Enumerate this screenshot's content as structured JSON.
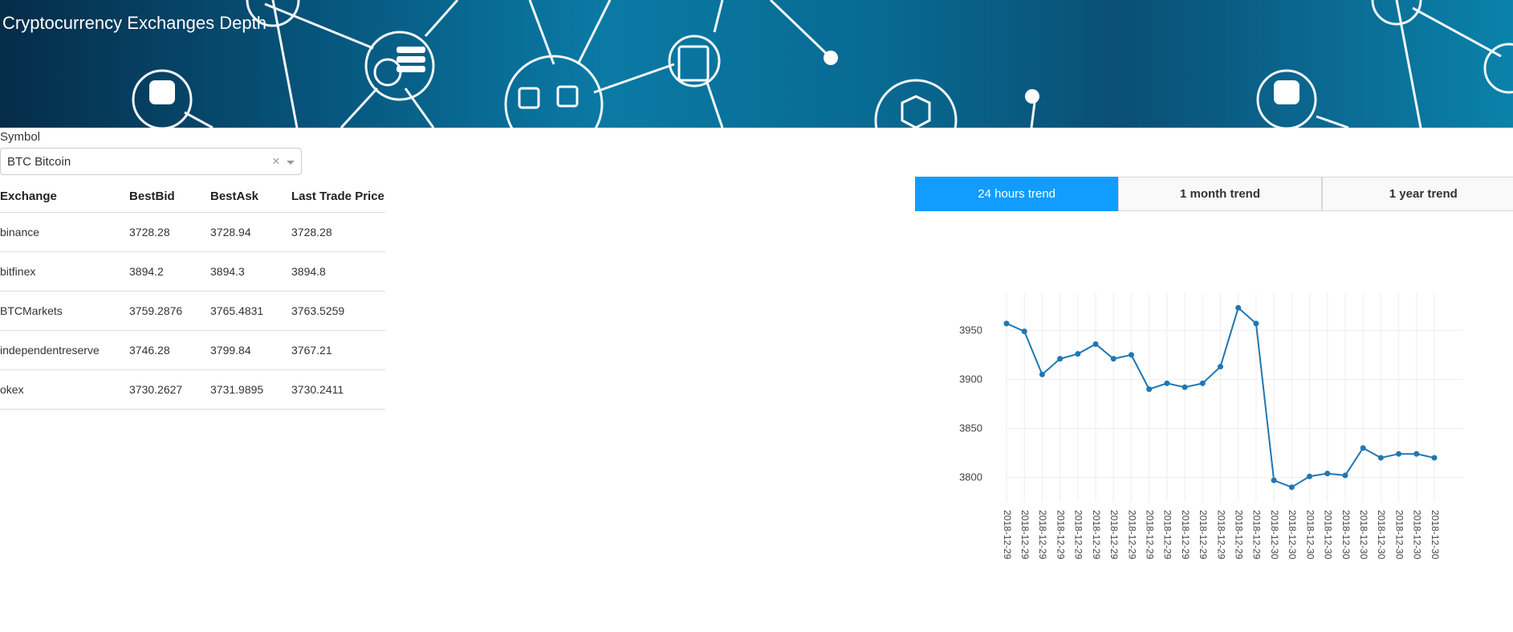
{
  "banner": {
    "title": "Cryptocurrency Exchanges Depth"
  },
  "symbol": {
    "label": "Symbol",
    "value": "BTC Bitcoin",
    "clear": "×"
  },
  "table": {
    "headers": [
      "Exchange",
      "BestBid",
      "BestAsk",
      "Last Trade Price"
    ],
    "rows": [
      [
        "binance",
        "3728.28",
        "3728.94",
        "3728.28"
      ],
      [
        "bitfinex",
        "3894.2",
        "3894.3",
        "3894.8"
      ],
      [
        "BTCMarkets",
        "3759.2876",
        "3765.4831",
        "3763.5259"
      ],
      [
        "independentreserve",
        "3746.28",
        "3799.84",
        "3767.21"
      ],
      [
        "okex",
        "3730.2627",
        "3731.9895",
        "3730.2411"
      ]
    ]
  },
  "tabs": [
    {
      "label": "24 hours trend",
      "active": true
    },
    {
      "label": "1 month trend",
      "active": false
    },
    {
      "label": "1 year trend",
      "active": false
    }
  ],
  "colors": {
    "accent": "#119dff",
    "line": "#1f77b4",
    "banner": "#07577e"
  },
  "chart_data": {
    "type": "line",
    "x": [
      "2018-12-29",
      "2018-12-29",
      "2018-12-29",
      "2018-12-29",
      "2018-12-29",
      "2018-12-29",
      "2018-12-29",
      "2018-12-29",
      "2018-12-29",
      "2018-12-29",
      "2018-12-29",
      "2018-12-29",
      "2018-12-29",
      "2018-12-29",
      "2018-12-29",
      "2018-12-30",
      "2018-12-30",
      "2018-12-30",
      "2018-12-30",
      "2018-12-30",
      "2018-12-30",
      "2018-12-30",
      "2018-12-30",
      "2018-12-30",
      "2018-12-30"
    ],
    "values": [
      3957,
      3949,
      3905,
      3921,
      3926,
      3936,
      3921,
      3925,
      3890,
      3896,
      3892,
      3896,
      3913,
      3973,
      3957,
      3797,
      3790,
      3801,
      3804,
      3802,
      3830,
      3820,
      3824,
      3824,
      3820
    ],
    "yticks": [
      3800,
      3850,
      3900,
      3950
    ],
    "ylim": [
      3775,
      3988
    ],
    "grid": true,
    "xlabel": "",
    "ylabel": "",
    "title": ""
  }
}
